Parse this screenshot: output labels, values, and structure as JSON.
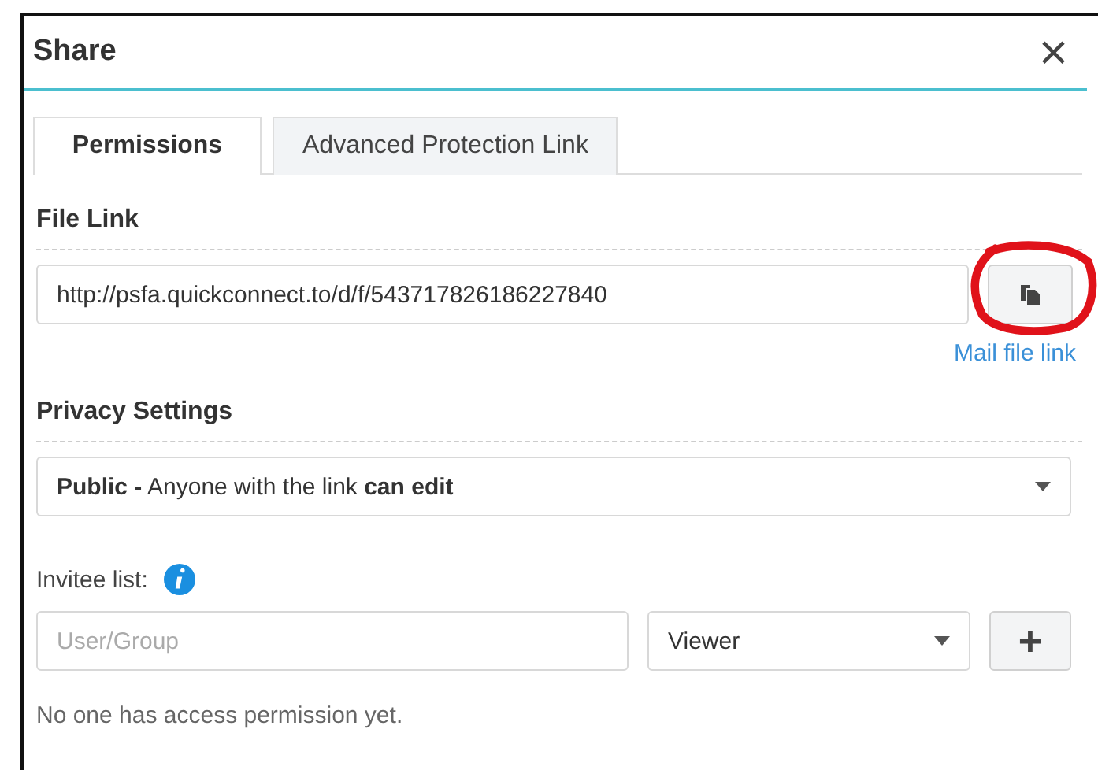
{
  "dialog": {
    "title": "Share",
    "close": "×"
  },
  "tabs": [
    {
      "label": "Permissions",
      "selected": true
    },
    {
      "label": "Advanced Protection Link",
      "selected": false
    }
  ],
  "file_link": {
    "heading": "File Link",
    "value": "http://psfa.quickconnect.to/d/f/543717826186227840",
    "mail_link": "Mail file link"
  },
  "privacy": {
    "heading": "Privacy Settings",
    "value": "**Public -** Anyone with the link **can edit**"
  },
  "invitees": {
    "label": "Invitee list:",
    "user_placeholder": "User/Group",
    "role": "Viewer",
    "add": "+",
    "empty_message": "No one has access permission yet."
  }
}
